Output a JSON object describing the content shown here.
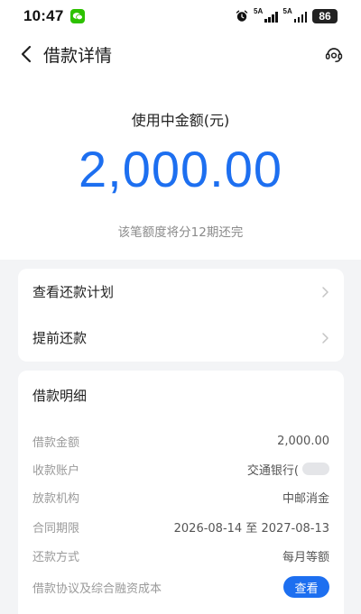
{
  "status_bar": {
    "time": "10:47",
    "signal_1_label": "5A",
    "signal_2_label": "5A",
    "battery": "86"
  },
  "nav": {
    "title": "借款详情"
  },
  "hero": {
    "label": "使用中金额(元)",
    "amount": "2,000.00",
    "note": "该笔额度将分12期还完"
  },
  "actions": [
    {
      "label": "查看还款计划"
    },
    {
      "label": "提前还款"
    }
  ],
  "detail": {
    "title": "借款明细",
    "rows": [
      {
        "key": "借款金额",
        "value": "2,000.00"
      },
      {
        "key": "收款账户",
        "value": "交通银行("
      },
      {
        "key": "放款机构",
        "value": "中邮消金"
      },
      {
        "key": "合同期限",
        "value": "2026-08-14 至 2027-08-13"
      },
      {
        "key": "还款方式",
        "value": "每月等额"
      },
      {
        "key": "借款协议及综合融资成本",
        "button": "查看"
      }
    ]
  },
  "colors": {
    "accent": "#1d6ff0",
    "wechat": "#2dc100",
    "background_gray": "#f3f4f6"
  }
}
